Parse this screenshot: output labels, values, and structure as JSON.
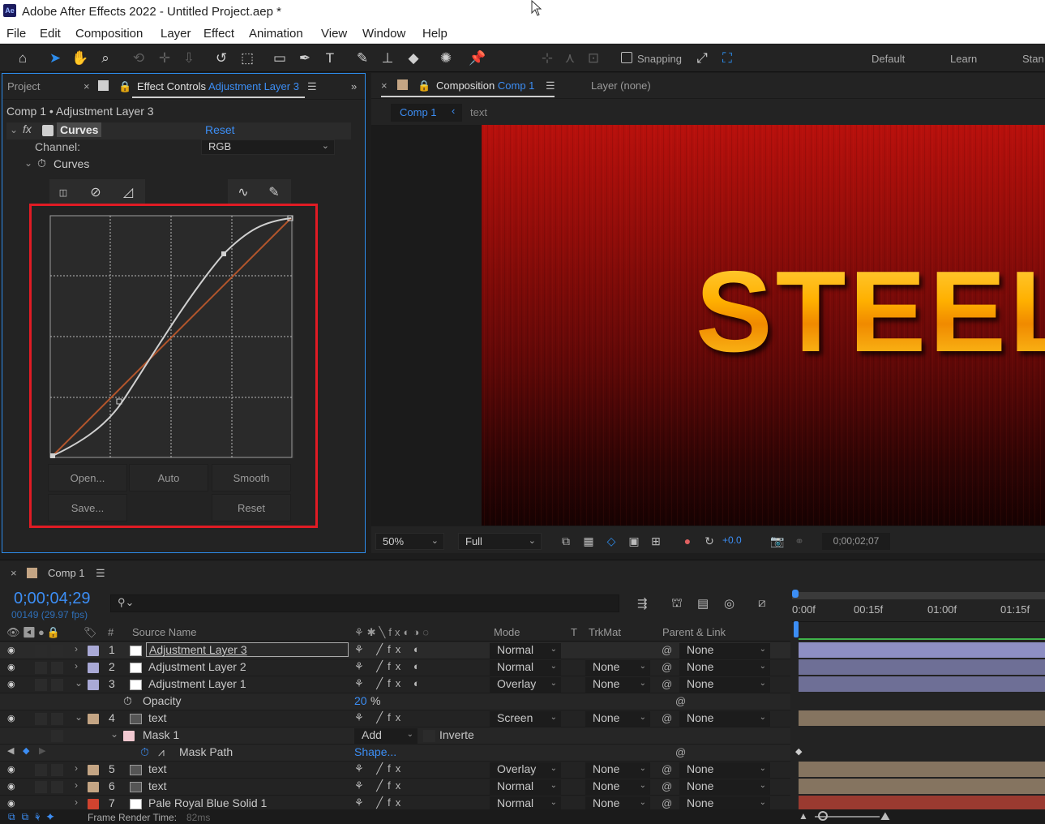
{
  "window": {
    "title": "Adobe After Effects 2022 - Untitled Project.aep *",
    "app_icon": "Ae"
  },
  "menu": [
    "File",
    "Edit",
    "Composition",
    "Layer",
    "Effect",
    "Animation",
    "View",
    "Window",
    "Help"
  ],
  "toolbar": {
    "snapping_label": "Snapping",
    "workspaces": [
      "Default",
      "Learn",
      "Stan"
    ]
  },
  "left_panel": {
    "tab_project": "Project",
    "tab_effect_controls": "Effect Controls",
    "tab_effect_controls_layer": "Adjustment Layer 3",
    "header": "Comp 1 • Adjustment Layer 3",
    "effect_name": "Curves",
    "reset_label": "Reset",
    "channel_label": "Channel:",
    "channel_value": "RGB",
    "curves_prop_label": "Curves",
    "buttons": {
      "open": "Open...",
      "auto": "Auto",
      "smooth": "Smooth",
      "save": "Save...",
      "reset": "Reset"
    }
  },
  "right_panel": {
    "tab_composition": "Composition",
    "tab_composition_name": "Comp 1",
    "tab_layer": "Layer (none)",
    "breadcrumb_comp": "Comp 1",
    "breadcrumb_text": "text",
    "canvas_text": "STEEL",
    "zoom": "50%",
    "resolution": "Full",
    "exposure": "+0.0",
    "timecode": "0;00;02;07"
  },
  "timeline": {
    "tab": "Comp 1",
    "timecode": "0;00;04;29",
    "frames": "00149 (29.97 fps)",
    "columns": {
      "num": "#",
      "source": "Source Name",
      "mode": "Mode",
      "t": "T",
      "trkmat": "TrkMat",
      "parent": "Parent & Link"
    },
    "ruler": [
      "0:00f",
      "00:15f",
      "01:00f",
      "01:15f"
    ],
    "layers": [
      {
        "num": "1",
        "name": "Adjustment Layer 3",
        "mode": "Normal",
        "trkmat": "",
        "parent": "None"
      },
      {
        "num": "2",
        "name": "Adjustment Layer 2",
        "mode": "Normal",
        "trkmat": "None",
        "parent": "None"
      },
      {
        "num": "3",
        "name": "Adjustment Layer 1",
        "mode": "Overlay",
        "trkmat": "None",
        "parent": "None"
      },
      {
        "num": "4",
        "name": "text",
        "mode": "Screen",
        "trkmat": "None",
        "parent": "None"
      },
      {
        "num": "5",
        "name": "text",
        "mode": "Overlay",
        "trkmat": "None",
        "parent": "None"
      },
      {
        "num": "6",
        "name": "text",
        "mode": "Normal",
        "trkmat": "None",
        "parent": "None"
      },
      {
        "num": "7",
        "name": "Pale Royal Blue Solid 1",
        "mode": "Normal",
        "trkmat": "None",
        "parent": "None"
      }
    ],
    "opacity_label": "Opacity",
    "opacity_value": "20",
    "opacity_unit": "%",
    "mask_label": "Mask 1",
    "mask_mode": "Add",
    "mask_inverted": "Inverte",
    "mask_path_label": "Mask Path",
    "mask_path_value": "Shape..."
  },
  "status": {
    "label": "Frame Render Time:",
    "value": "82ms"
  }
}
